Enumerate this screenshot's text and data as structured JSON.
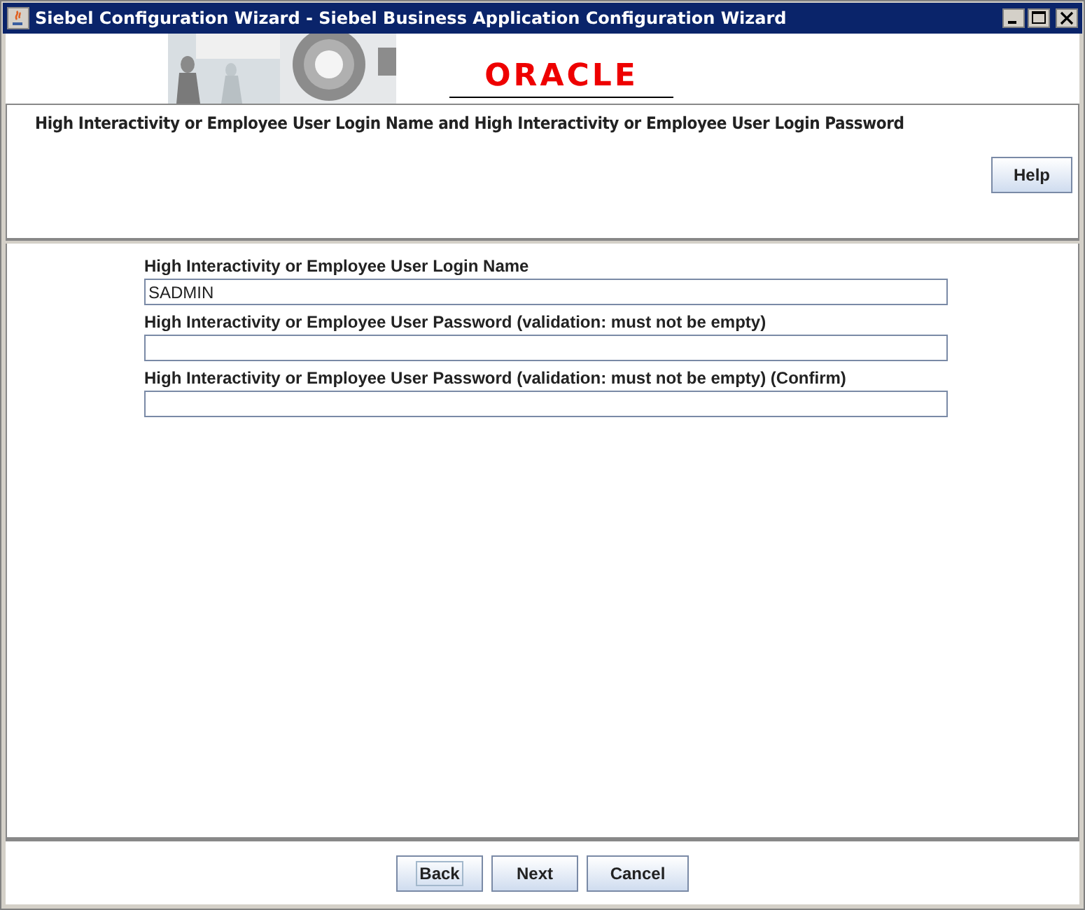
{
  "window": {
    "title": "Siebel Configuration Wizard - Siebel Business Application Configuration Wizard"
  },
  "banner": {
    "logo": "ORACLE"
  },
  "header": {
    "description": "High Interactivity or Employee User Login Name and High Interactivity or Employee User Login Password",
    "help_button": "Help"
  },
  "fields": [
    {
      "label": "High Interactivity or Employee User Login Name",
      "value": "SADMIN"
    },
    {
      "label": "High Interactivity or Employee User Password (validation: must not be empty)"
    },
    {
      "label": "High Interactivity or Employee User Password (validation: must not be empty) (Confirm)"
    }
  ],
  "buttons": [
    {
      "label": "Back",
      "focused": true
    },
    {
      "label": "Next",
      "focused": false
    },
    {
      "label": "Cancel",
      "focused": false
    }
  ]
}
